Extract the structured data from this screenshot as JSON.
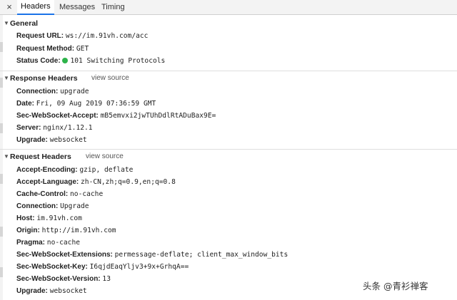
{
  "tabs": {
    "close_glyph": "×",
    "items": [
      {
        "label": "Headers",
        "active": true
      },
      {
        "label": "Messages",
        "active": false
      },
      {
        "label": "Timing",
        "active": false
      }
    ]
  },
  "general": {
    "title": "General",
    "rows": [
      {
        "key": "Request URL:",
        "value": "ws://im.91vh.com/acc"
      },
      {
        "key": "Request Method:",
        "value": "GET"
      },
      {
        "key": "Status Code:",
        "value": "101 Switching Protocols",
        "status_color": "#2db34a"
      }
    ]
  },
  "response_headers": {
    "title": "Response Headers",
    "view_source": "view source",
    "rows": [
      {
        "key": "Connection:",
        "value": "upgrade"
      },
      {
        "key": "Date:",
        "value": "Fri, 09 Aug 2019 07:36:59 GMT"
      },
      {
        "key": "Sec-WebSocket-Accept:",
        "value": "mB5emvxi2jwTUhDdlRtADuBax9E="
      },
      {
        "key": "Server:",
        "value": "nginx/1.12.1"
      },
      {
        "key": "Upgrade:",
        "value": "websocket"
      }
    ]
  },
  "request_headers": {
    "title": "Request Headers",
    "view_source": "view source",
    "rows": [
      {
        "key": "Accept-Encoding:",
        "value": "gzip, deflate"
      },
      {
        "key": "Accept-Language:",
        "value": "zh-CN,zh;q=0.9,en;q=0.8"
      },
      {
        "key": "Cache-Control:",
        "value": "no-cache"
      },
      {
        "key": "Connection:",
        "value": "Upgrade"
      },
      {
        "key": "Host:",
        "value": "im.91vh.com"
      },
      {
        "key": "Origin:",
        "value": "http://im.91vh.com"
      },
      {
        "key": "Pragma:",
        "value": "no-cache"
      },
      {
        "key": "Sec-WebSocket-Extensions:",
        "value": "permessage-deflate; client_max_window_bits"
      },
      {
        "key": "Sec-WebSocket-Key:",
        "value": "I6qjdEaqYljv3+9x+GrhqA=="
      },
      {
        "key": "Sec-WebSocket-Version:",
        "value": "13"
      },
      {
        "key": "Upgrade:",
        "value": "websocket"
      }
    ]
  },
  "watermark": "头条 @青衫禅客"
}
